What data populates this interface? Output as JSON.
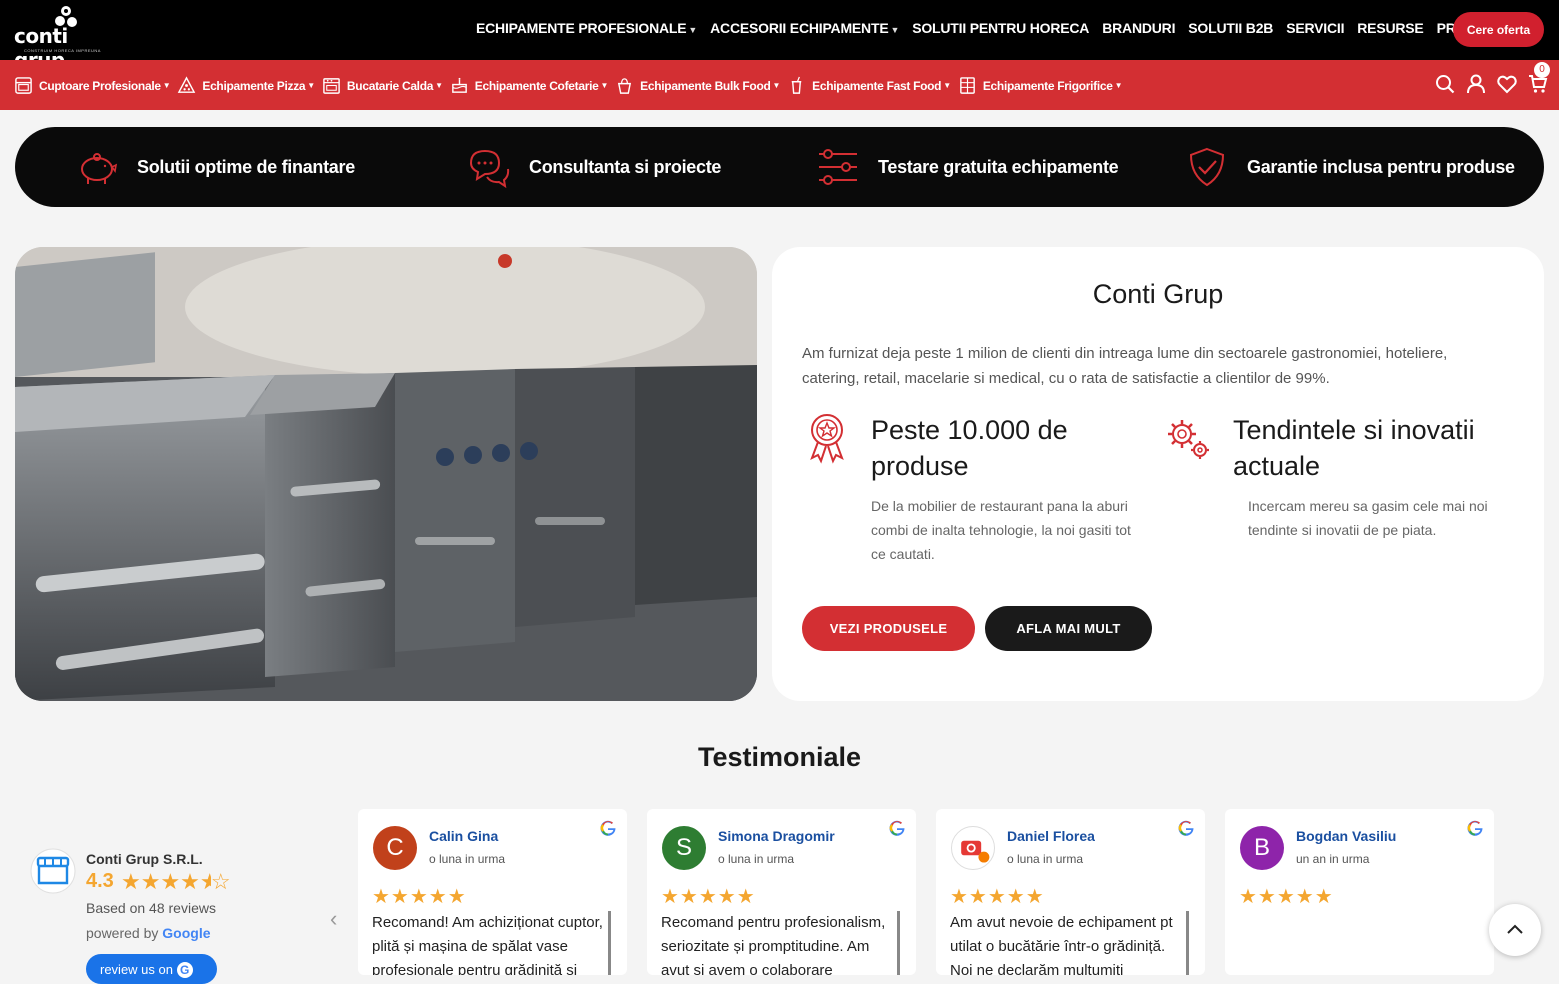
{
  "brand": {
    "logo_text": "conti grup",
    "tagline": "CONSTRUIM HORECA IMPREUNA"
  },
  "topnav": {
    "items": [
      {
        "label": "ECHIPAMENTE PROFESIONALE",
        "dropdown": true
      },
      {
        "label": "ACCESORII ECHIPAMENTE",
        "dropdown": true
      },
      {
        "label": "SOLUTII PENTRU HORECA",
        "dropdown": false
      },
      {
        "label": "BRANDURI",
        "dropdown": false
      },
      {
        "label": "SOLUTII B2B",
        "dropdown": false
      },
      {
        "label": "SERVICII",
        "dropdown": false
      },
      {
        "label": "RESURSE",
        "dropdown": false
      },
      {
        "label": "PROMOTII",
        "dropdown": false
      }
    ],
    "caret": "▼",
    "offer_button": "Cere oferta"
  },
  "categories": {
    "items": [
      {
        "label": "Cuptoare Profesionale",
        "icon": "oven-icon"
      },
      {
        "label": "Echipamente Pizza",
        "icon": "pizza-icon"
      },
      {
        "label": "Bucatarie Calda",
        "icon": "stove-icon"
      },
      {
        "label": "Echipamente Cofetarie",
        "icon": "cake-icon"
      },
      {
        "label": "Echipamente Bulk Food",
        "icon": "bulk-food-icon"
      },
      {
        "label": "Echipamente Fast Food",
        "icon": "fast-food-icon"
      },
      {
        "label": "Echipamente Frigorifice",
        "icon": "fridge-icon"
      }
    ],
    "caret": "▼",
    "cart_count": "0"
  },
  "benefits": [
    {
      "label": "Solutii optime de finantare",
      "icon": "piggy-bank-icon"
    },
    {
      "label": "Consultanta si proiecte",
      "icon": "chat-bubbles-icon"
    },
    {
      "label": "Testare gratuita echipamente",
      "icon": "sliders-icon"
    },
    {
      "label": "Garantie inclusa pentru produse",
      "icon": "shield-check-icon"
    }
  ],
  "about": {
    "title": "Conti Grup",
    "lead": "Am furnizat deja peste 1 milion de clienti din intreaga lume din sectoarele gastronomiei, hoteliere, catering, retail, macelarie si medical, cu o rata de satisfactie a clientilor de 99%.",
    "features": [
      {
        "title": "Peste 10.000 de produse",
        "text": "De la mobilier de restaurant pana la aburi combi de inalta tehnologie, la noi gasiti tot ce cautati.",
        "icon": "award-ribbon-icon"
      },
      {
        "title": "Tendintele si inovatii actuale",
        "text": "Incercam mereu sa gasim cele mai noi tendinte si inovatii de pe piata.",
        "icon": "gears-icon"
      }
    ],
    "primary_button": "VEZI PRODUSELE",
    "secondary_button": "AFLA MAI MULT"
  },
  "testimonials": {
    "title": "Testimoniale",
    "summary": {
      "company": "Conti Grup S.R.L.",
      "rating": "4.3",
      "rating_value": 4.3,
      "based_on": "Based on 48 reviews",
      "powered_by": "powered by",
      "google": "Google",
      "review_button": "review us on"
    },
    "reviews": [
      {
        "initial": "C",
        "name": "Calin Gina",
        "when": "o luna in urma",
        "stars": 5,
        "color": "#c1411b",
        "text": "Recomand! Am achiziționat cuptor, plită și mașina de spălat vase profesionale pentru grădiniță și"
      },
      {
        "initial": "S",
        "name": "Simona Dragomir",
        "when": "o luna in urma",
        "stars": 5,
        "color": "#2e7d32",
        "text": "Recomand pentru profesionalism, seriozitate și promptitudine. Am avut și avem o colaborare"
      },
      {
        "initial": "",
        "name": "Daniel Florea",
        "when": "o luna in urma",
        "stars": 5,
        "color": "#ffffff",
        "text": "Am avut nevoie de echipament pt utilat o bucătărie într-o grădiniță. Noi ne declarăm mulțumiți"
      },
      {
        "initial": "B",
        "name": "Bogdan Vasiliu",
        "when": "un an in urma",
        "stars": 5,
        "color": "#8e24aa",
        "text": ""
      }
    ]
  },
  "colors": {
    "brand_red": "#d32f33",
    "dark": "#0a0a0a",
    "star": "#f4a630",
    "link_blue": "#1a4fa0"
  }
}
